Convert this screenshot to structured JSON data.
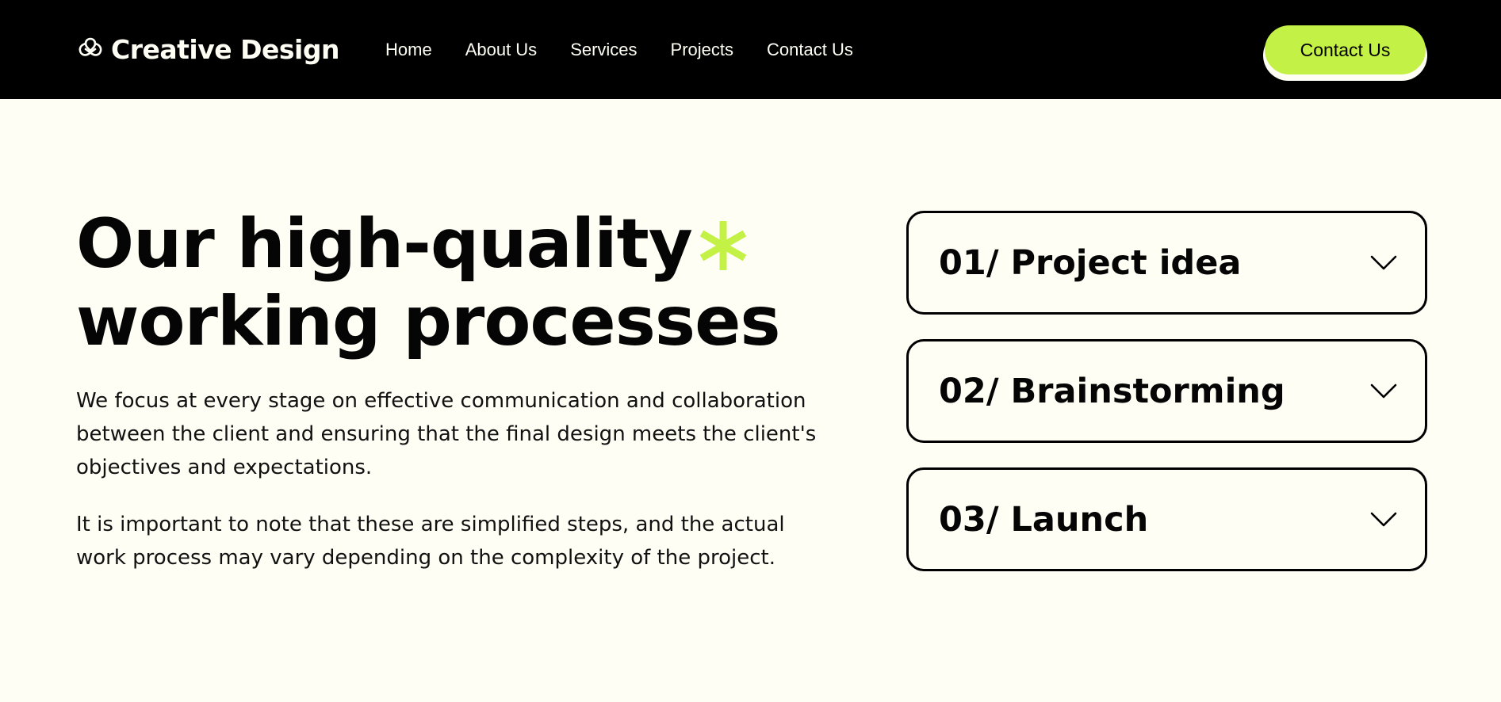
{
  "brand": {
    "name": "Creative Design",
    "icon": "trefoil-knot-icon"
  },
  "nav": {
    "links": [
      "Home",
      "About Us",
      "Services",
      "Projects",
      "Contact Us"
    ],
    "cta_label": "Contact Us"
  },
  "hero": {
    "title_line1": "Our high-quality",
    "title_line2": "working processes",
    "decor_icon": "asterisk-icon",
    "paragraph1": "We focus at every stage on effective communication and collaboration between the client and ensuring that the final design meets the client's objectives and expectations.",
    "paragraph2": "It is important to note that these are simplified steps, and the actual work process may vary depending on the complexity of the project."
  },
  "steps": [
    {
      "label": "01/ Project idea",
      "icon": "chevron-down-icon"
    },
    {
      "label": "02/ Brainstorming",
      "icon": "chevron-down-icon"
    },
    {
      "label": "03/ Launch",
      "icon": "chevron-down-icon"
    }
  ],
  "colors": {
    "background": "#FEFEF4",
    "navbar": "#000000",
    "accent": "#C4F145",
    "text": "#050505"
  }
}
